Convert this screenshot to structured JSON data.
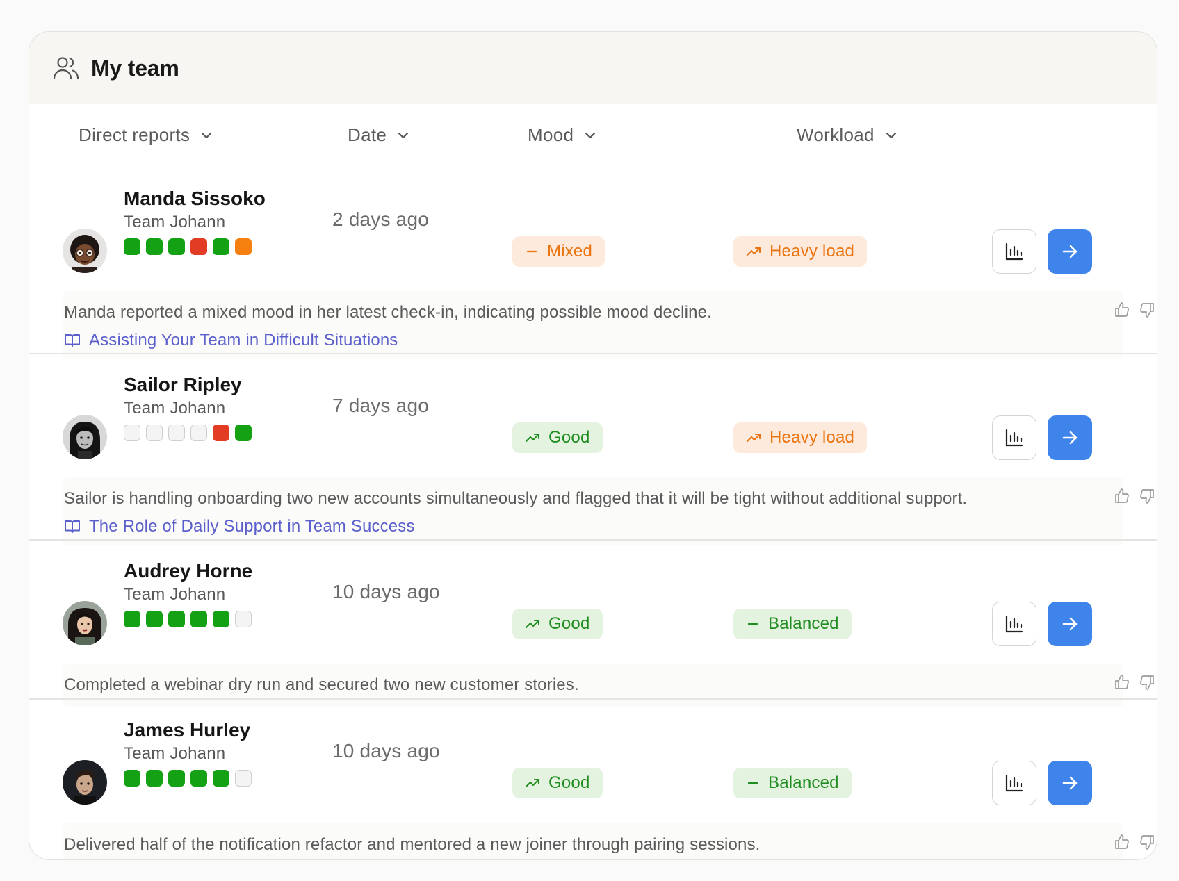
{
  "header": {
    "title": "My team",
    "icon": "users-icon"
  },
  "columns": [
    {
      "label": "Direct reports"
    },
    {
      "label": "Date"
    },
    {
      "label": "Mood"
    },
    {
      "label": "Workload"
    }
  ],
  "colors": {
    "accent_blue": "#3f84ea",
    "good_green": "#14a114",
    "alert_red": "#e23c24",
    "warn_orange": "#f5800f",
    "link_purple": "#5b5fcc"
  },
  "reports": [
    {
      "name": "Manda Sissoko",
      "team": "Team Johann",
      "dots": [
        "green",
        "green",
        "green",
        "red",
        "green",
        "orange"
      ],
      "date": "2 days ago",
      "mood": {
        "label": "Mixed",
        "tone": "orange",
        "icon": "minus-icon"
      },
      "workload": {
        "label": "Heavy load",
        "tone": "orange",
        "icon": "trend-up-icon"
      },
      "note": "Manda reported a mixed mood in her latest check-in, indicating possible mood decline.",
      "link": "Assisting Your Team in Difficult Situations"
    },
    {
      "name": "Sailor Ripley",
      "team": "Team Johann",
      "dots": [
        "empty",
        "empty",
        "empty",
        "empty",
        "red",
        "green"
      ],
      "date": "7 days ago",
      "mood": {
        "label": "Good",
        "tone": "green",
        "icon": "trend-up-icon"
      },
      "workload": {
        "label": "Heavy load",
        "tone": "orange",
        "icon": "trend-up-icon"
      },
      "note": "Sailor is handling onboarding two new accounts simultaneously and flagged that it will be tight without additional support.",
      "link": "The Role of Daily Support in Team Success"
    },
    {
      "name": "Audrey Horne",
      "team": "Team Johann",
      "dots": [
        "green",
        "green",
        "green",
        "green",
        "green",
        "empty"
      ],
      "date": "10 days ago",
      "mood": {
        "label": "Good",
        "tone": "green",
        "icon": "trend-up-icon"
      },
      "workload": {
        "label": "Balanced",
        "tone": "green",
        "icon": "minus-icon"
      },
      "note": "Completed a webinar dry run and secured two new customer stories.",
      "link": null
    },
    {
      "name": "James Hurley",
      "team": "Team Johann",
      "dots": [
        "green",
        "green",
        "green",
        "green",
        "green",
        "empty"
      ],
      "date": "10 days ago",
      "mood": {
        "label": "Good",
        "tone": "green",
        "icon": "trend-up-icon"
      },
      "workload": {
        "label": "Balanced",
        "tone": "green",
        "icon": "minus-icon"
      },
      "note": "Delivered half of the notification refactor and mentored a new joiner through pairing sessions.",
      "link": null
    }
  ]
}
